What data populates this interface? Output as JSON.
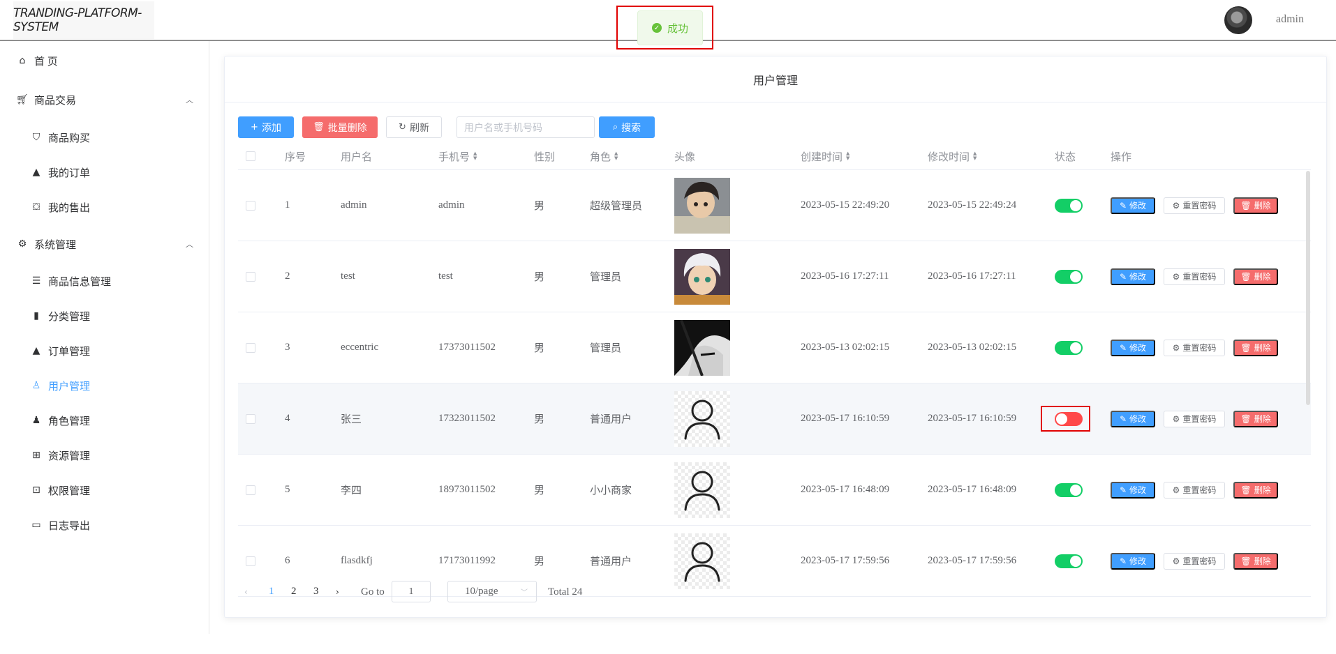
{
  "header": {
    "logo_text": "TRANDING-PLATFORM-SYSTEM",
    "user_name": "admin"
  },
  "toast": {
    "text": "成功",
    "type": "success"
  },
  "sidebar": {
    "items": [
      {
        "label": "首 页",
        "icon": "home-icon"
      },
      {
        "label": "商品交易",
        "icon": "cart-icon",
        "expanded": true
      },
      {
        "label": "商品购买",
        "icon": "shopping-bag-icon"
      },
      {
        "label": "我的订单",
        "icon": "bag-icon"
      },
      {
        "label": "我的售出",
        "icon": "bag-out-icon"
      },
      {
        "label": "系统管理",
        "icon": "gear-icon",
        "expanded": true
      },
      {
        "label": "商品信息管理",
        "icon": "sliders-icon"
      },
      {
        "label": "分类管理",
        "icon": "bar-chart-icon"
      },
      {
        "label": "订单管理",
        "icon": "bag-icon"
      },
      {
        "label": "用户管理",
        "icon": "user-icon",
        "active": true
      },
      {
        "label": "角色管理",
        "icon": "user-solid-icon"
      },
      {
        "label": "资源管理",
        "icon": "box-icon"
      },
      {
        "label": "权限管理",
        "icon": "lock-icon"
      },
      {
        "label": "日志导出",
        "icon": "folder-icon"
      }
    ]
  },
  "card": {
    "title": "用户管理"
  },
  "toolbar": {
    "add_label": "添加",
    "batch_delete_label": "批量删除",
    "refresh_label": "刷新",
    "search_placeholder": "用户名或手机号码",
    "search_label": "搜索"
  },
  "table": {
    "columns": [
      "序号",
      "用户名",
      "手机号",
      "性别",
      "角色",
      "头像",
      "创建时间",
      "修改时间",
      "状态",
      "操作"
    ],
    "action_labels": {
      "edit": "修改",
      "reset": "重置密码",
      "delete": "删除"
    },
    "rows": [
      {
        "index": "1",
        "username": "admin",
        "phone": "admin",
        "gender": "男",
        "role": "超级管理员",
        "avatar": "anime-boy-dark-hair",
        "created": "2023-05-15 22:49:20",
        "modified": "2023-05-15 22:49:24",
        "status": true
      },
      {
        "index": "2",
        "username": "test",
        "phone": "test",
        "gender": "男",
        "role": "管理员",
        "avatar": "anime-boy-white-hair",
        "created": "2023-05-16 17:27:11",
        "modified": "2023-05-16 17:27:11",
        "status": true
      },
      {
        "index": "3",
        "username": "eccentric",
        "phone": "17373011502",
        "gender": "男",
        "role": "管理员",
        "avatar": "anime-dark-portrait",
        "created": "2023-05-13 02:02:15",
        "modified": "2023-05-13 02:02:15",
        "status": true
      },
      {
        "index": "4",
        "username": "张三",
        "phone": "17323011502",
        "gender": "男",
        "role": "普通用户",
        "avatar": "default-user",
        "created": "2023-05-17 16:10:59",
        "modified": "2023-05-17 16:10:59",
        "status": false
      },
      {
        "index": "5",
        "username": "李四",
        "phone": "18973011502",
        "gender": "男",
        "role": "小小商家",
        "avatar": "default-user",
        "created": "2023-05-17 16:48:09",
        "modified": "2023-05-17 16:48:09",
        "status": true
      },
      {
        "index": "6",
        "username": "flasdkfj",
        "phone": "17173011992",
        "gender": "男",
        "role": "普通用户",
        "avatar": "default-user",
        "created": "2023-05-17 17:59:56",
        "modified": "2023-05-17 17:59:56",
        "status": true
      }
    ]
  },
  "pagination": {
    "pages": [
      "1",
      "2",
      "3"
    ],
    "current": "1",
    "goto_label": "Go to",
    "goto_value": "1",
    "page_size": "10/page",
    "total": "Total 24"
  },
  "colors": {
    "primary": "#409eff",
    "danger": "#f56c6c",
    "switch_on": "#13ce66",
    "switch_off": "#ff4949",
    "success": "#67c23a"
  }
}
